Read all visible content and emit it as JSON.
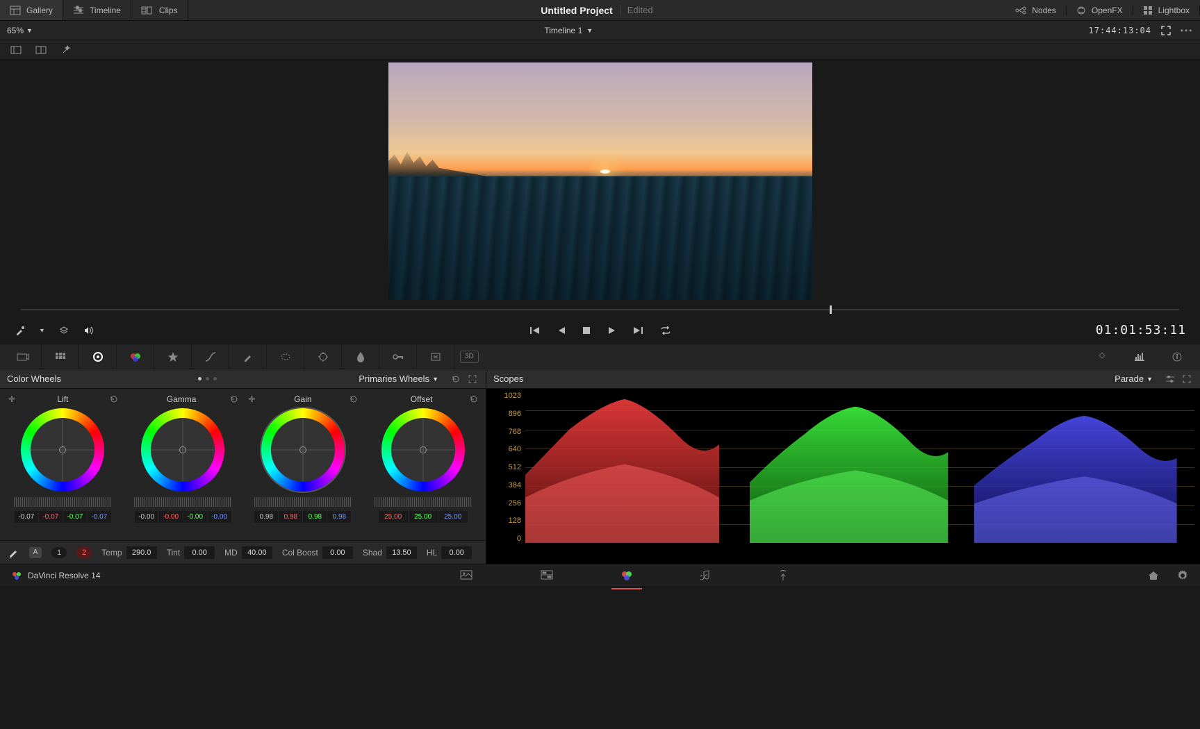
{
  "topbar": {
    "gallery": "Gallery",
    "timeline": "Timeline",
    "clips": "Clips",
    "nodes": "Nodes",
    "openfx": "OpenFX",
    "lightbox": "Lightbox",
    "project_title": "Untitled Project",
    "project_status": "Edited"
  },
  "subbar": {
    "zoom": "65%",
    "timeline_name": "Timeline 1",
    "timecode": "17:44:13:04"
  },
  "transport": {
    "timecode": "01:01:53:11"
  },
  "panels": {
    "color_wheels_title": "Color Wheels",
    "primaries_label": "Primaries Wheels",
    "scopes_title": "Scopes",
    "parade_label": "Parade"
  },
  "wheels": {
    "lift": {
      "label": "Lift",
      "vals": [
        "-0.07",
        "-0.07",
        "-0.07",
        "-0.07"
      ]
    },
    "gamma": {
      "label": "Gamma",
      "vals": [
        "-0.00",
        "-0.00",
        "-0.00",
        "-0.00"
      ]
    },
    "gain": {
      "label": "Gain",
      "vals": [
        "0.98",
        "0.98",
        "0.98",
        "0.98"
      ]
    },
    "offset": {
      "label": "Offset",
      "vals": [
        "25.00",
        "25.00",
        "25.00"
      ]
    }
  },
  "adjust": {
    "mode_1": "1",
    "mode_2": "2",
    "temp_label": "Temp",
    "temp": "290.0",
    "tint_label": "Tint",
    "tint": "0.00",
    "md_label": "MD",
    "md": "40.00",
    "colboost_label": "Col Boost",
    "colboost": "0.00",
    "shad_label": "Shad",
    "shad": "13.50",
    "hl_label": "HL",
    "hl": "0.00"
  },
  "scope_axis": [
    "1023",
    "896",
    "768",
    "640",
    "512",
    "384",
    "256",
    "128",
    "0"
  ],
  "bottombar": {
    "app_name": "DaVinci Resolve 14"
  },
  "tool3d": "3D"
}
